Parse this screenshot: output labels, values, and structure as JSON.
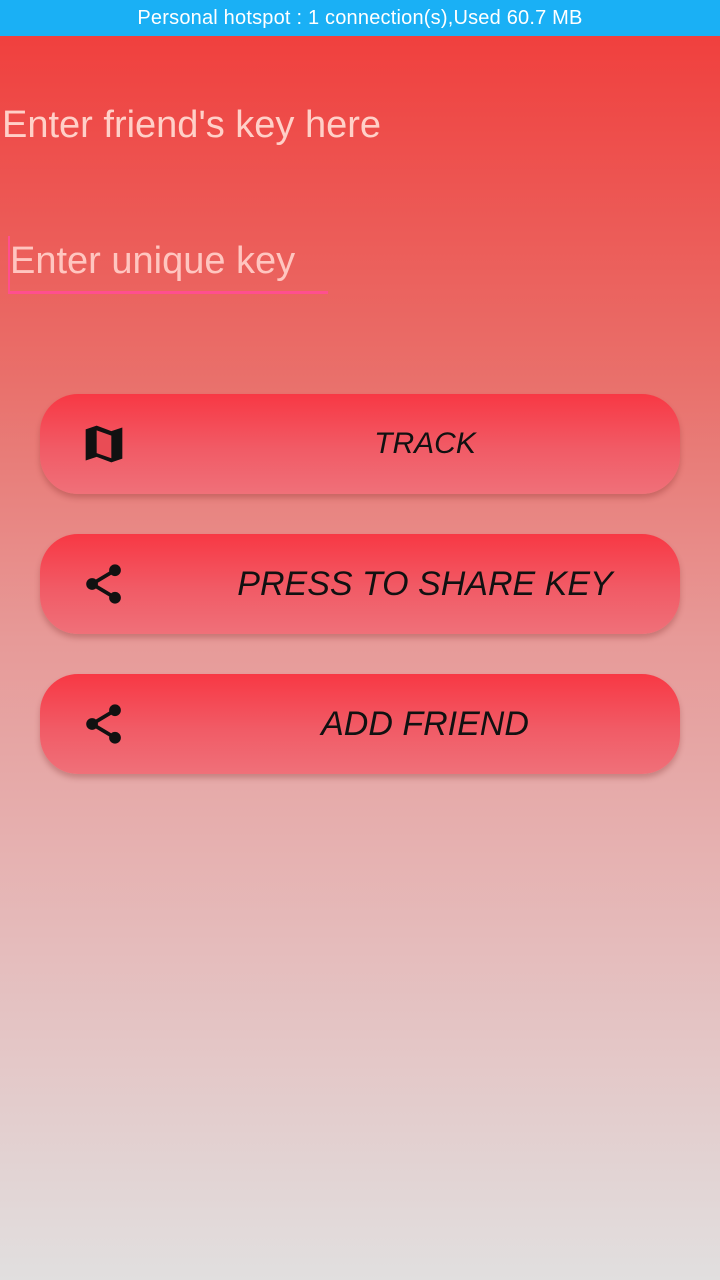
{
  "status_bar": {
    "text": "Personal hotspot : 1 connection(s),Used  60.7 MB"
  },
  "heading": {
    "text": "Enter friend's key here"
  },
  "key_input": {
    "placeholder": "Enter unique key",
    "value": ""
  },
  "buttons": {
    "track": {
      "label": "TRACK",
      "icon": "map-icon"
    },
    "share_key": {
      "label": "PRESS TO SHARE KEY",
      "icon": "share-icon"
    },
    "add_friend": {
      "label": "ADD FRIEND",
      "icon": "share-icon"
    }
  },
  "colors": {
    "status_bar": "#1ab0f5",
    "accent_underline": "#ff4f8e",
    "button": "#f83844"
  }
}
